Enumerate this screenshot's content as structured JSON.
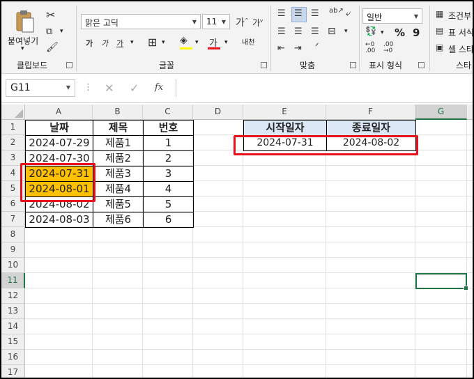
{
  "ribbon": {
    "clipboard": {
      "paste_label": "붙여넣기",
      "group_label": "클립보드"
    },
    "font": {
      "font_name": "맑은 고딕",
      "font_size": "11",
      "group_label": "글꼴",
      "phonetic_label": "내천"
    },
    "alignment": {
      "group_label": "맞춤"
    },
    "number": {
      "format": "일반",
      "group_label": "표시 형식",
      "percent": "%",
      "comma": "9"
    },
    "styles": {
      "conditional": "조건부",
      "table_format": "표 서식",
      "cell_styles": "셀 스타",
      "group_label": "스타"
    }
  },
  "formula_bar": {
    "name_box": "G11",
    "fx": "fx",
    "formula": ""
  },
  "grid": {
    "columns": [
      "A",
      "B",
      "C",
      "D",
      "E",
      "F",
      "G"
    ],
    "rows": [
      "1",
      "2",
      "3",
      "4",
      "5",
      "6",
      "7",
      "8",
      "9",
      "10",
      "11",
      "12",
      "13",
      "14",
      "15",
      "16",
      "17"
    ],
    "selected_column": "G",
    "selected_row": "11",
    "table1": {
      "headers": [
        "날짜",
        "제목",
        "번호"
      ],
      "rows": [
        [
          "2024-07-29",
          "제품1",
          "1"
        ],
        [
          "2024-07-30",
          "제품2",
          "2"
        ],
        [
          "2024-07-31",
          "제품3",
          "3"
        ],
        [
          "2024-08-01",
          "제품4",
          "4"
        ],
        [
          "2024-08-02",
          "제품5",
          "5"
        ],
        [
          "2024-08-03",
          "제품6",
          "6"
        ]
      ]
    },
    "table2": {
      "headers": [
        "시작일자",
        "종료일자"
      ],
      "values": [
        "2024-07-31",
        "2024-08-02"
      ]
    }
  },
  "colors": {
    "highlight": "#ffc000",
    "annotation": "#e8101a",
    "accent": "#217346",
    "header_fill": "#dde8f7"
  }
}
